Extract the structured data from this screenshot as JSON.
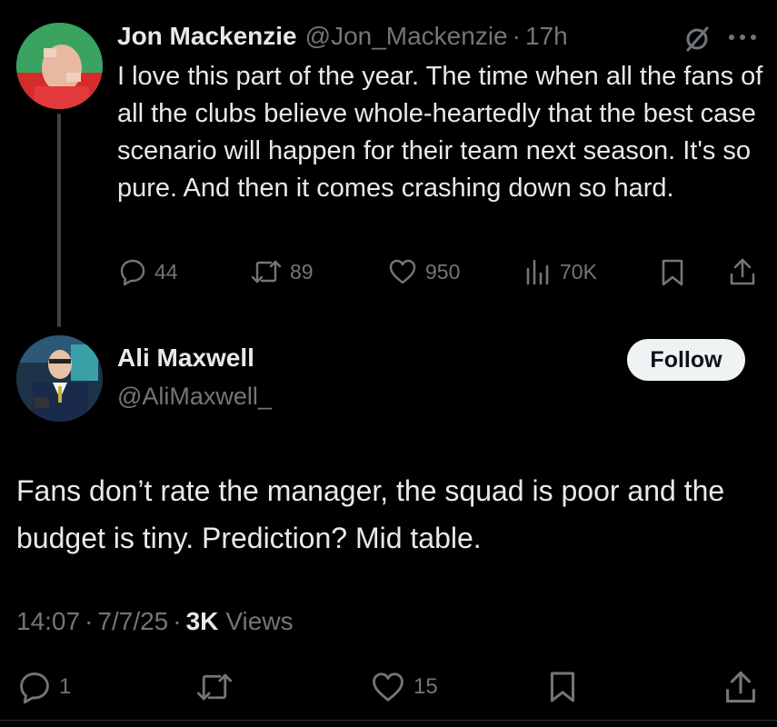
{
  "parent_tweet": {
    "author_name": "Jon Mackenzie",
    "author_handle": "@Jon_Mackenzie",
    "separator": "·",
    "time": "17h",
    "text": "I love this part of the year. The time when all the fans of all the clubs believe whole-heartedly that the best case scenario will happen for their team next season. It's so pure. And then it comes crashing down so hard.",
    "stats": {
      "replies": "44",
      "reposts": "89",
      "likes": "950",
      "views": "70K"
    }
  },
  "main_tweet": {
    "author_name": "Ali Maxwell",
    "author_handle": "@AliMaxwell_",
    "follow_label": "Follow",
    "text": "Fans don’t rate the manager, the squad is poor and the budget is tiny. Prediction? Mid table.",
    "time": "14:07",
    "date": "7/7/25",
    "separator": "·",
    "views_count": "3K",
    "views_label": "Views",
    "stats": {
      "replies": "1",
      "likes": "15"
    }
  },
  "colors": {
    "background": "#000000",
    "text_primary": "#e7e9ea",
    "text_secondary": "#71767b",
    "follow_bg": "#eff3f4",
    "thread_line": "#3d4145"
  },
  "icons": [
    "grok-icon",
    "more-icon",
    "reply-icon",
    "repost-icon",
    "like-icon",
    "views-icon",
    "bookmark-icon",
    "share-icon"
  ]
}
